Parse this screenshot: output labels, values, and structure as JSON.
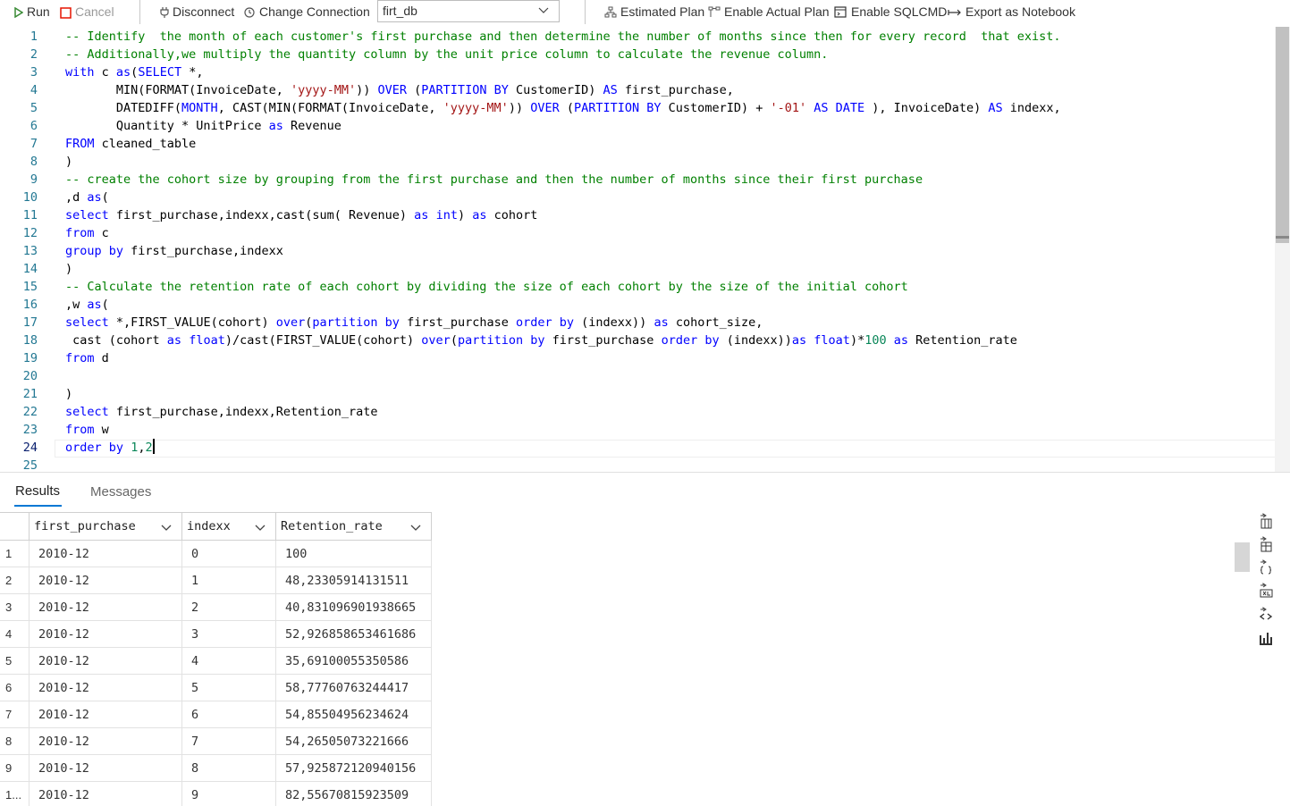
{
  "toolbar": {
    "run_label": "Run",
    "cancel_label": "Cancel",
    "disconnect_label": "Disconnect",
    "change_connection_label": "Change Connection",
    "database": "firt_db",
    "estimated_plan_label": "Estimated Plan",
    "enable_actual_plan_label": "Enable Actual Plan",
    "enable_sqlcmd_label": "Enable SQLCMD",
    "export_notebook_label": "Export as Notebook",
    "run_color": "#388a34",
    "cancel_color": "#e51400"
  },
  "editor": {
    "line_numbers": [
      "1",
      "2",
      "3",
      "4",
      "5",
      "6",
      "7",
      "8",
      "9",
      "10",
      "11",
      "12",
      "13",
      "14",
      "15",
      "16",
      "17",
      "18",
      "19",
      "20",
      "21",
      "22",
      "23",
      "24",
      "25"
    ],
    "active_line": "24",
    "lines": [
      "-- Identify  the month of each customer's first purchase and then determine the number of months since then for every record  that exist.",
      "-- Additionally,we multiply the quantity column by the unit price column to calculate the revenue column.",
      "with c as(SELECT *,",
      "       MIN(FORMAT(InvoiceDate, 'yyyy-MM')) OVER (PARTITION BY CustomerID) AS first_purchase,",
      "       DATEDIFF(MONTH, CAST(MIN(FORMAT(InvoiceDate, 'yyyy-MM')) OVER (PARTITION BY CustomerID) + '-01' AS DATE ), InvoiceDate) AS indexx,",
      "       Quantity * UnitPrice as Revenue",
      "FROM cleaned_table",
      ")",
      "-- create the cohort size by grouping from the first purchase and then the number of months since their first purchase",
      ",d as(",
      "select first_purchase,indexx,cast(sum( Revenue) as int) as cohort",
      "from c",
      "group by first_purchase,indexx",
      ")",
      "-- Calculate the retention rate of each cohort by dividing the size of each cohort by the size of the initial cohort",
      ",w as(",
      "select *,FIRST_VALUE(cohort) over(partition by first_purchase order by (indexx)) as cohort_size,",
      " cast (cohort as float)/cast(FIRST_VALUE(cohort) over(partition by first_purchase order by (indexx))as float)*100 as Retention_rate",
      "from d",
      "",
      ")",
      "select first_purchase,indexx,Retention_rate",
      "from w",
      "order by 1,2",
      ""
    ]
  },
  "results": {
    "tabs": [
      "Results",
      "Messages"
    ],
    "columns": [
      "first_purchase",
      "indexx",
      "Retention_rate"
    ],
    "rows": [
      [
        "1",
        "2010-12",
        "0",
        "100"
      ],
      [
        "2",
        "2010-12",
        "1",
        "48,23305914131511"
      ],
      [
        "3",
        "2010-12",
        "2",
        "40,831096901938665"
      ],
      [
        "4",
        "2010-12",
        "3",
        "52,926858653461686"
      ],
      [
        "5",
        "2010-12",
        "4",
        "35,69100055350586"
      ],
      [
        "6",
        "2010-12",
        "5",
        "58,77760763244417"
      ],
      [
        "7",
        "2010-12",
        "6",
        "54,85504956234624"
      ],
      [
        "8",
        "2010-12",
        "7",
        "54,26505073221666"
      ],
      [
        "9",
        "2010-12",
        "8",
        "57,925872120940156"
      ],
      [
        "1...",
        "2010-12",
        "9",
        "82,55670815923509"
      ]
    ],
    "side_icons": [
      "save-as-csv-icon",
      "save-as-excel-icon",
      "save-as-json-icon",
      "save-as-xml-icon",
      "save-as-markdown-icon",
      "chart-icon"
    ]
  }
}
